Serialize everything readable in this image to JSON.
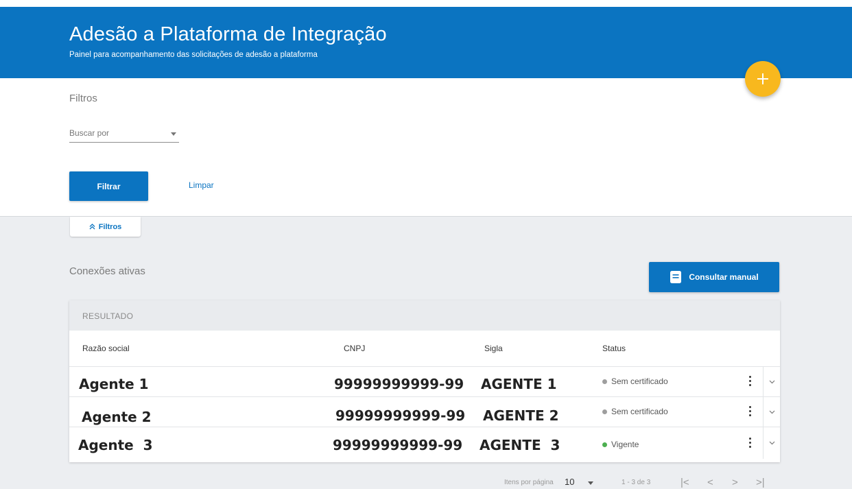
{
  "header": {
    "title": "Adesão a Plataforma de Integração",
    "subtitle": "Painel para acompanhamento das solicitações de adesão a plataforma",
    "fab_icon": "plus-icon"
  },
  "filters": {
    "title": "Filtros",
    "search_select_label": "Buscar por",
    "filter_button": "Filtrar",
    "clear_button": "Limpar",
    "toggle_tab": "Filtros"
  },
  "connections": {
    "title": "Conexões ativas",
    "manual_button": "Consultar manual",
    "manual_icon": "book-icon"
  },
  "table": {
    "result_label": "RESULTADO",
    "columns": [
      "Razão social",
      "CNPJ",
      "Sigla",
      "Status"
    ],
    "rows": [
      {
        "razao": "Agente 1",
        "cnpj": "99999999999-99",
        "sigla": "AGENTE 1",
        "status": "Sem certificado",
        "status_color": "#9e9e9e"
      },
      {
        "razao": "Agente 2",
        "cnpj": "99999999999-99",
        "sigla": "AGENTE 2",
        "status": "Sem certificado",
        "status_color": "#9e9e9e"
      },
      {
        "razao": "Agente  3",
        "cnpj": "99999999999-99",
        "sigla": "AGENTE  3",
        "status": "Vigente",
        "status_color": "#4caf50"
      }
    ]
  },
  "pagination": {
    "items_per_page_label": "Itens por página",
    "items_per_page_value": "10",
    "range": "1 - 3 de 3",
    "first": "|<",
    "prev": "<",
    "next": ">",
    "last": ">|"
  },
  "colors": {
    "primary": "#0b74c1",
    "fab": "#f8b81e",
    "background": "#eceef1"
  }
}
